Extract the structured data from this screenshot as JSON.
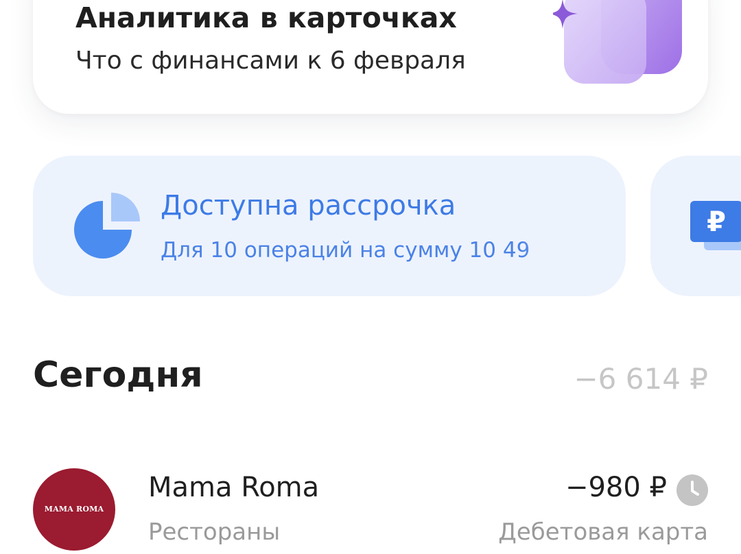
{
  "analytics_card": {
    "title": "Аналитика в карточках",
    "subtitle": "Что с финансами к 6 февраля",
    "icon": "cards-sparkle-icon"
  },
  "installment_banner": {
    "title": "Доступна рассрочка",
    "subtitle": "Для 10 операций на сумму 10 49",
    "icon": "pie-chart-icon"
  },
  "next_banner": {
    "icon": "ruble-card-icon"
  },
  "today": {
    "title": "Сегодня",
    "total": "−6 614 ₽"
  },
  "transactions": [
    {
      "name": "Mama Roma",
      "category": "Рестораны",
      "amount": "−980 ₽",
      "account": "Дебетовая карта",
      "avatar_text": "MAMA ROMA",
      "avatar_color": "#9b1b30",
      "status_icon": "clock-icon"
    }
  ],
  "colors": {
    "accent_blue": "#3d7be6",
    "banner_bg": "#edf3fd",
    "muted_text": "#9a9a9a",
    "purple": "#9b6fe0"
  }
}
